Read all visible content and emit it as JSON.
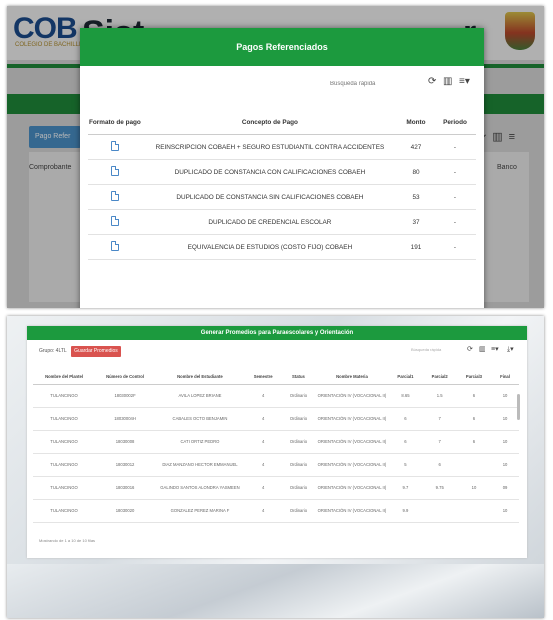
{
  "panel1": {
    "background": {
      "logo_text": "COB",
      "logo_sub": "COLEGIO DE BACHILLERES",
      "title_left": "Sist",
      "title_right": "r",
      "button_label": "Pago Refer",
      "label_left": "Comprobante",
      "label_right": "Banco"
    },
    "modal": {
      "title": "Pagos Referenciados",
      "search_placeholder": "Búsqueda rápida",
      "columns": [
        "Formato de pago",
        "Concepto de Pago",
        "Monto",
        "Periodo"
      ],
      "rows": [
        {
          "concepto": "REINSCRIPCION COBAEH + SEGURO ESTUDIANTIL CONTRA ACCIDENTES",
          "monto": "427",
          "periodo": "-"
        },
        {
          "concepto": "DUPLICADO DE CONSTANCIA CON CALIFICACIONES COBAEH",
          "monto": "80",
          "periodo": "-"
        },
        {
          "concepto": "DUPLICADO DE CONSTANCIA SIN CALIFICACIONES COBAEH",
          "monto": "53",
          "periodo": "-"
        },
        {
          "concepto": "DUPLICADO DE CREDENCIAL ESCOLAR",
          "monto": "37",
          "periodo": "-"
        },
        {
          "concepto": "EQUIVALENCIA DE ESTUDIOS (COSTO FIJO) COBAEH",
          "monto": "191",
          "periodo": "-"
        }
      ]
    }
  },
  "panel2": {
    "title": "Generar Promedios para Paraescolares y Orientación",
    "label_left": "Grupo: 4LTL",
    "button_label": "Guardar Promedios",
    "search_placeholder": "Búsqueda rápida",
    "columns": [
      "Nombre del Plantel",
      "Número de Control",
      "Nombre del Estudiante",
      "Semestre",
      "Status",
      "Nombre Materia",
      "Parcial1",
      "Parcial2",
      "Parcial3",
      "Final"
    ],
    "rows": [
      {
        "plantel": "TULANCINGO",
        "control": "18030002F",
        "nombre": "AVILA LOPEZ BRIANE",
        "semestre": "4",
        "status": "Ordinario",
        "materia": "ORIENTACIÓN IV (VOCACIONAL II)",
        "p1": "8.65",
        "p2": "1.5",
        "p3": "6",
        "final": "10"
      },
      {
        "plantel": "TULANCINGO",
        "control": "18030004H",
        "nombre": "CABALES OCTO BENJAMIN",
        "semestre": "4",
        "status": "Ordinario",
        "materia": "ORIENTACIÓN IV (VOCACIONAL II)",
        "p1": "6",
        "p2": "7",
        "p3": "6",
        "final": "10"
      },
      {
        "plantel": "TULANCINGO",
        "control": "18030008",
        "nombre": "CATI ORTIZ PEDRO",
        "semestre": "4",
        "status": "Ordinario",
        "materia": "ORIENTACIÓN IV (VOCACIONAL II)",
        "p1": "6",
        "p2": "7",
        "p3": "6",
        "final": "10"
      },
      {
        "plantel": "TULANCINGO",
        "control": "18030012",
        "nombre": "DIAZ MANZANO HECTOR EMMANUEL",
        "semestre": "4",
        "status": "Ordinario",
        "materia": "ORIENTACIÓN IV (VOCACIONAL II)",
        "p1": "5",
        "p2": "6",
        "p3": "",
        "final": "10"
      },
      {
        "plantel": "TULANCINGO",
        "control": "18030016",
        "nombre": "GALINDO SANTOS ALONDRA YASMEEN",
        "semestre": "4",
        "status": "Ordinario",
        "materia": "ORIENTACIÓN IV (VOCACIONAL II)",
        "p1": "9.7",
        "p2": "9.75",
        "p3": "10",
        "final": "09"
      },
      {
        "plantel": "TULANCINGO",
        "control": "18030020",
        "nombre": "GONZALEZ PEREZ MARINA F",
        "semestre": "4",
        "status": "Ordinario",
        "materia": "ORIENTACIÓN IV (VOCACIONAL II)",
        "p1": "9.9",
        "p2": "",
        "p3": "",
        "final": "10"
      }
    ],
    "footer": "Mostrando de 1 a 10 de 10 filas"
  }
}
